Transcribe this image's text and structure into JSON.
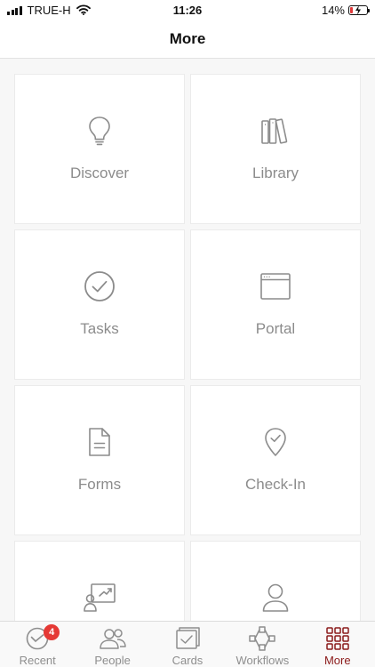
{
  "status_bar": {
    "carrier": "TRUE-H",
    "time": "11:26",
    "battery": "14%",
    "battery_level": 0.14
  },
  "header": {
    "title": "More"
  },
  "tiles": [
    {
      "label": "Discover",
      "icon": "lightbulb-icon"
    },
    {
      "label": "Library",
      "icon": "books-icon"
    },
    {
      "label": "Tasks",
      "icon": "check-circle-icon"
    },
    {
      "label": "Portal",
      "icon": "browser-window-icon"
    },
    {
      "label": "Forms",
      "icon": "document-icon"
    },
    {
      "label": "Check-In",
      "icon": "location-check-icon"
    },
    {
      "label": "",
      "icon": "presentation-icon"
    },
    {
      "label": "",
      "icon": "user-icon"
    }
  ],
  "tabbar": {
    "items": [
      {
        "label": "Recent",
        "icon": "clock-icon",
        "badge": "4"
      },
      {
        "label": "People",
        "icon": "people-icon"
      },
      {
        "label": "Cards",
        "icon": "cards-icon"
      },
      {
        "label": "Workflows",
        "icon": "workflow-icon"
      },
      {
        "label": "More",
        "icon": "grid-icon",
        "active": true
      }
    ]
  },
  "colors": {
    "accent": "#8b1a1a",
    "badge": "#e53935",
    "icon_gray": "#8c8c8c",
    "battery_low": "#e03a3a"
  }
}
